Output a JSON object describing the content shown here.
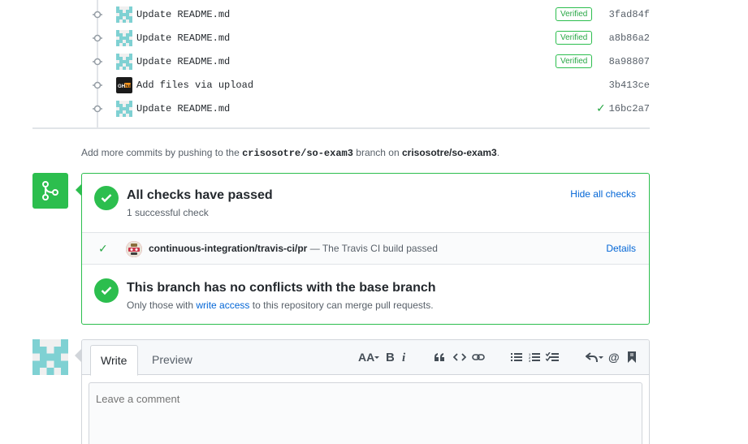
{
  "commits": [
    {
      "message": "Update README.md",
      "verified": "Verified",
      "sha": "3fad84f",
      "avatar": "identicon",
      "status": "verified"
    },
    {
      "message": "Update README.md",
      "verified": "Verified",
      "sha": "a8b86a2",
      "avatar": "identicon",
      "status": "verified"
    },
    {
      "message": "Update README.md",
      "verified": "Verified",
      "sha": "8a98807",
      "avatar": "identicon",
      "status": "verified"
    },
    {
      "message": "Add files via upload",
      "verified": "",
      "sha": "3b413ce",
      "avatar": "github-hub-logo",
      "status": "none"
    },
    {
      "message": "Update README.md",
      "verified": "",
      "sha": "16bc2a7",
      "avatar": "identicon",
      "status": "check"
    }
  ],
  "push_hint": {
    "prefix": "Add more commits by pushing to the",
    "branch": "crisosotre/so-exam3",
    "middle": "branch on",
    "repo": "crisosotre/so-exam3",
    "suffix": "."
  },
  "merge_box": {
    "checks_title": "All checks have passed",
    "checks_sub": "1 successful check",
    "hide_checks": "Hide all checks",
    "check_name": "continuous-integration/travis-ci/pr",
    "check_desc": "— The Travis CI build passed",
    "details": "Details",
    "conflict_title": "This branch has no conflicts with the base branch",
    "conflict_sub_prefix": "Only those with",
    "conflict_sub_link": "write access",
    "conflict_sub_suffix": "to this repository can merge pull requests."
  },
  "comment": {
    "tab_write": "Write",
    "tab_preview": "Preview",
    "placeholder": "Leave a comment",
    "toolbar": [
      "header-icon",
      "bold-icon",
      "italic-icon",
      "quote-icon",
      "code-icon",
      "link-icon",
      "unordered-list-icon",
      "ordered-list-icon",
      "task-list-icon",
      "reply-icon",
      "mention-icon",
      "saved-reply-icon"
    ]
  },
  "colors": {
    "success": "#2cbe4e",
    "link": "#0366d6",
    "identicon": "#7fd1d3"
  }
}
